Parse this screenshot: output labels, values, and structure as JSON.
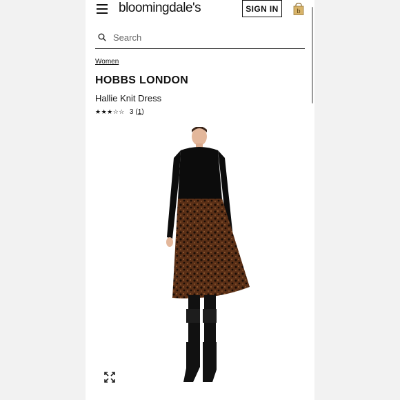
{
  "header": {
    "logo_text": "bloomingdale's",
    "signin_label": "SIGN IN"
  },
  "search": {
    "placeholder": "Search"
  },
  "breadcrumb": {
    "label": "Women"
  },
  "product": {
    "brand": "HOBBS LONDON",
    "name": "Hallie Knit Dress",
    "rating_value": 3,
    "rating_max": 5,
    "stars_filled": "★★★",
    "stars_empty": "☆☆",
    "rating_text": "3",
    "review_open": "(",
    "review_count": "1",
    "review_close": ")"
  },
  "colors": {
    "accent": "#111111",
    "bag": "#c9a45a",
    "dress_top": "#111111",
    "dress_skirt": "#6b3a1e"
  },
  "icons": {
    "menu": "hamburger-icon",
    "bag": "shopping-bag-icon",
    "search": "search-icon",
    "expand": "expand-icon"
  }
}
